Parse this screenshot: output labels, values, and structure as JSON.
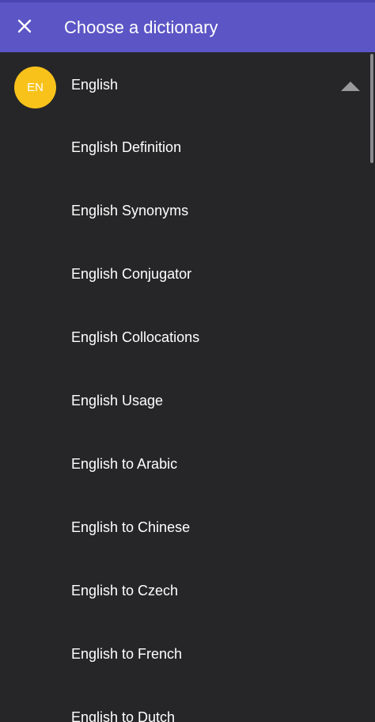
{
  "header": {
    "close_icon": "close-icon",
    "title": "Choose a dictionary"
  },
  "colors": {
    "header_bg": "#5b55c5",
    "background": "#262628",
    "avatar_bg": "#f8c21b"
  },
  "language": {
    "code": "EN",
    "label": "English",
    "expanded": true,
    "toggle_icon": "chevron-up-icon"
  },
  "dictionaries": [
    {
      "label": "English Definition"
    },
    {
      "label": "English Synonyms"
    },
    {
      "label": "English Conjugator"
    },
    {
      "label": "English Collocations"
    },
    {
      "label": "English Usage"
    },
    {
      "label": "English to Arabic"
    },
    {
      "label": "English to Chinese"
    },
    {
      "label": "English to Czech"
    },
    {
      "label": "English to French"
    },
    {
      "label": "English to Dutch"
    }
  ]
}
